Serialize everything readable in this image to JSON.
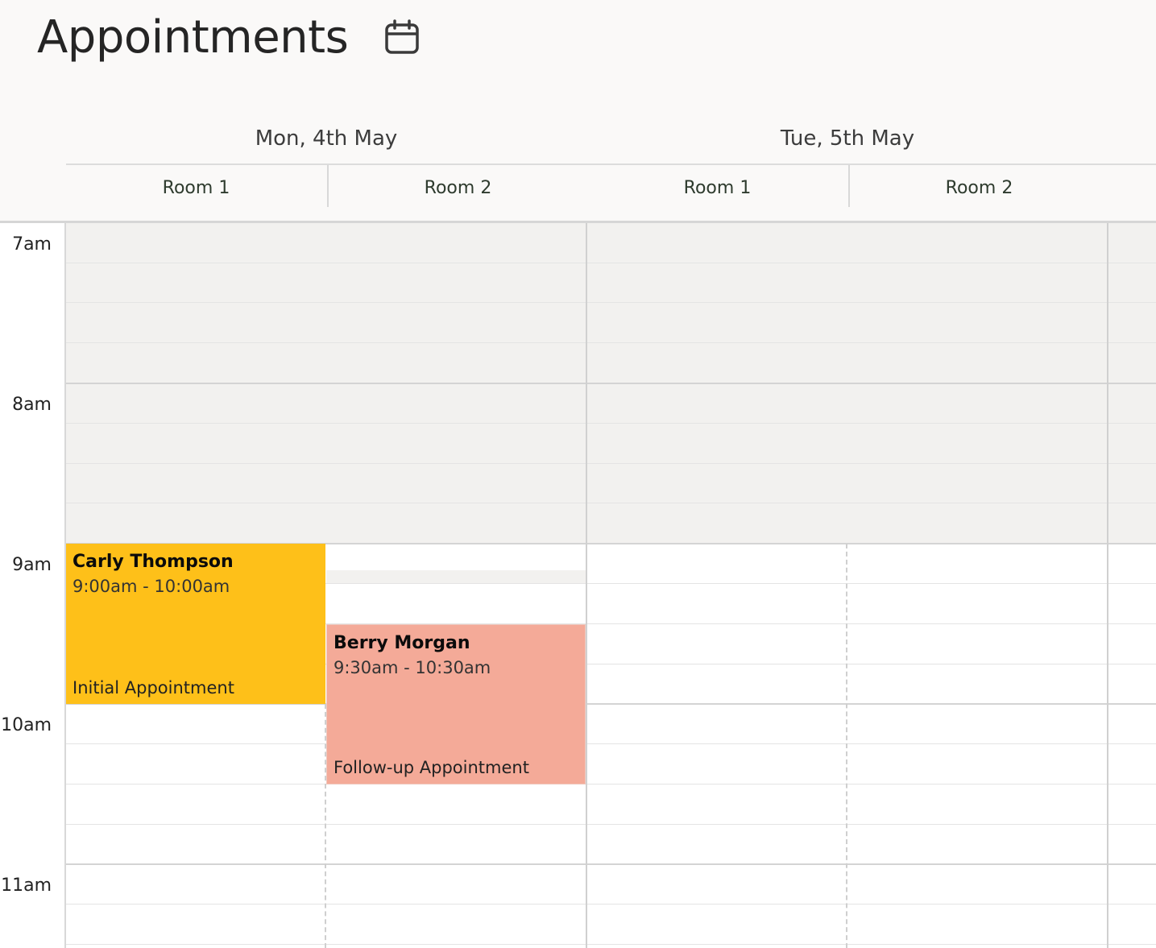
{
  "header": {
    "title": "Appointments",
    "calendar_icon": "calendar-icon"
  },
  "days": [
    {
      "label": "Mon, 4th May",
      "rooms": [
        "Room 1",
        "Room 2"
      ]
    },
    {
      "label": "Tue, 5th May",
      "rooms": [
        "Room 1",
        "Room 2"
      ]
    }
  ],
  "time_labels": [
    "7am",
    "8am",
    "9am",
    "10am",
    "11am"
  ],
  "appointments": [
    {
      "name": "Carly Thompson",
      "time": "9:00am - 10:00am",
      "type": "Initial Appointment",
      "day": "Mon, 4th May",
      "room": "Room 1",
      "color": "#fec019"
    },
    {
      "name": "Berry Morgan",
      "time": "9:30am - 10:30am",
      "type": "Follow-up Appointment",
      "day": "Mon, 4th May",
      "room": "Room 2",
      "color": "#f4aa98"
    }
  ],
  "colors": {
    "header_bg": "#faf9f8",
    "unavailable": "#f2f1ef",
    "grid_line": "#d4d4d4"
  }
}
